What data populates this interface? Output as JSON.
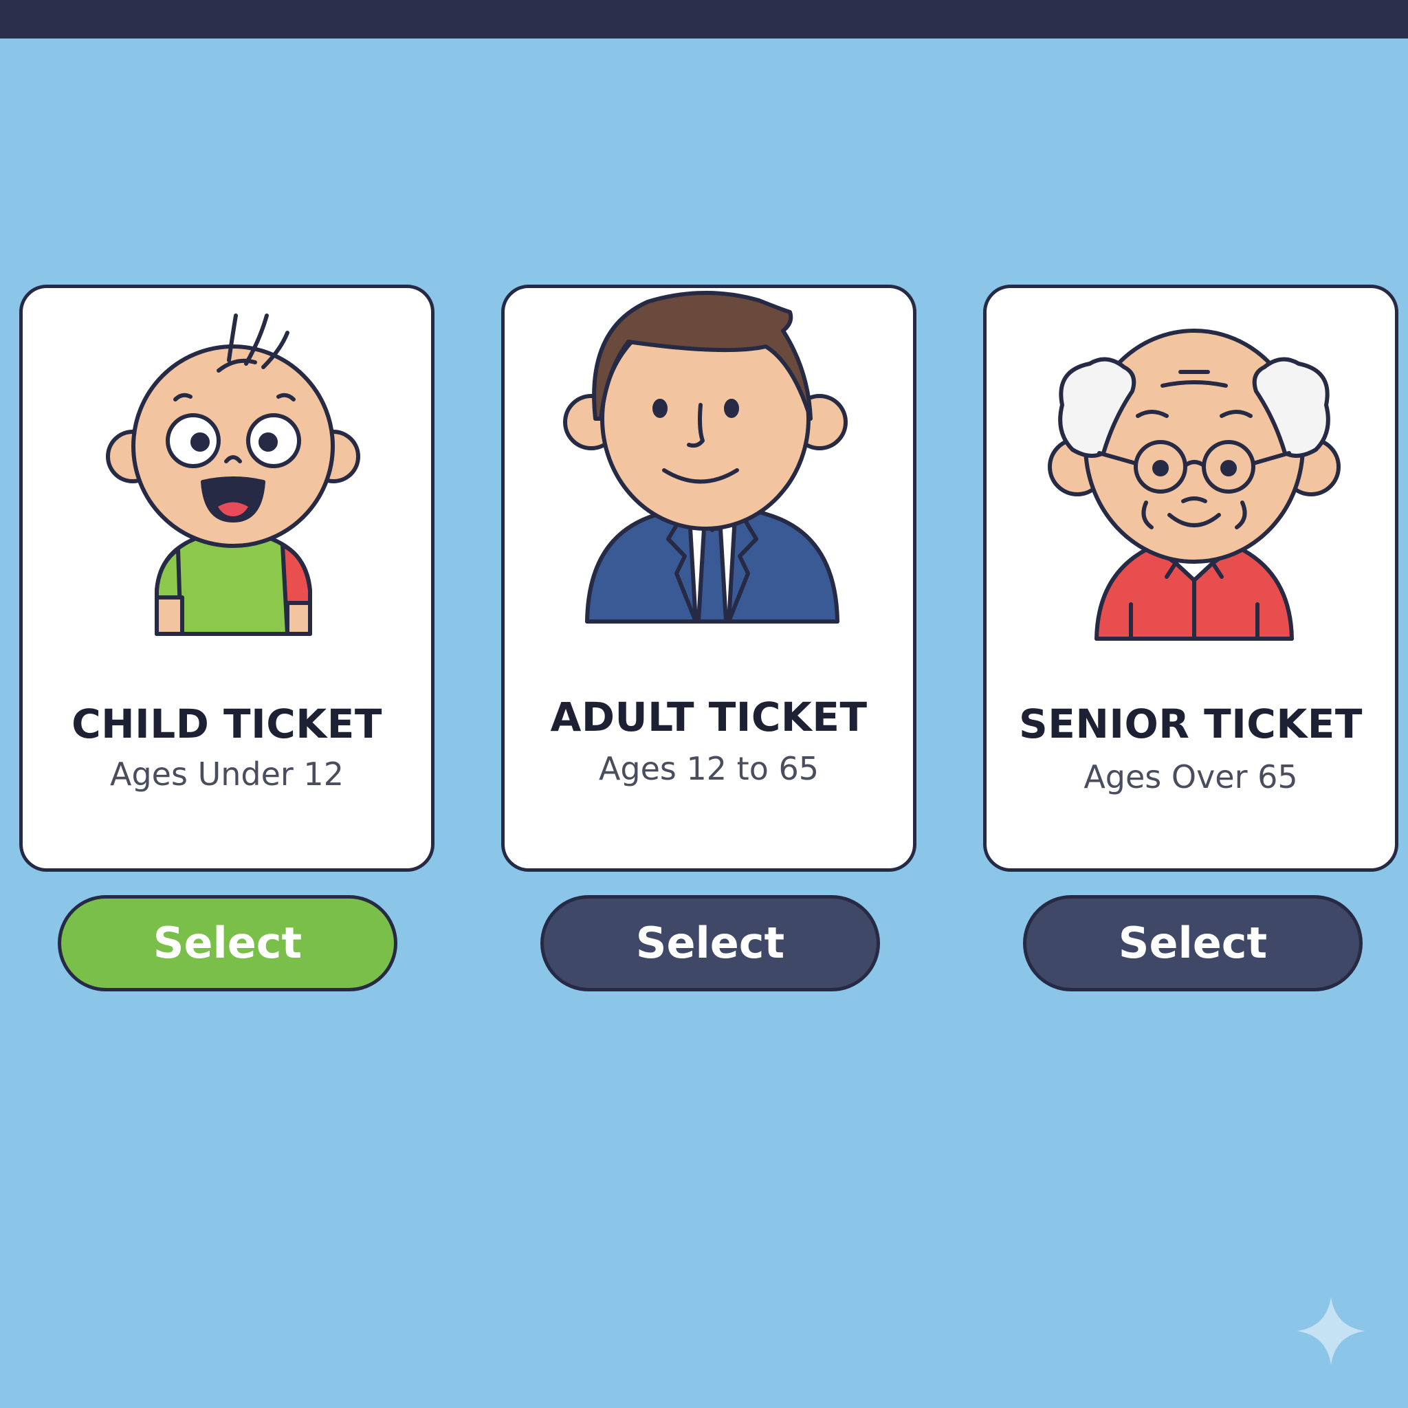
{
  "tickets": [
    {
      "id": "child",
      "title": "CHILD TICKET",
      "subtitle": "Ages Under 12",
      "button_label": "Select",
      "selected": true,
      "icon": "child-avatar-icon"
    },
    {
      "id": "adult",
      "title": "ADULT TICKET",
      "subtitle": "Ages 12 to 65",
      "button_label": "Select",
      "selected": false,
      "icon": "adult-avatar-icon"
    },
    {
      "id": "senior",
      "title": "SENIOR TICKET",
      "subtitle": "Ages Over 65",
      "button_label": "Select",
      "selected": false,
      "icon": "senior-avatar-icon"
    }
  ],
  "colors": {
    "background": "#8bc5e8",
    "topbar": "#2b2f4b",
    "selected_button": "#79bf4a",
    "default_button": "#3f4867",
    "outline": "#262a45",
    "skin": "#f2c5a0"
  }
}
